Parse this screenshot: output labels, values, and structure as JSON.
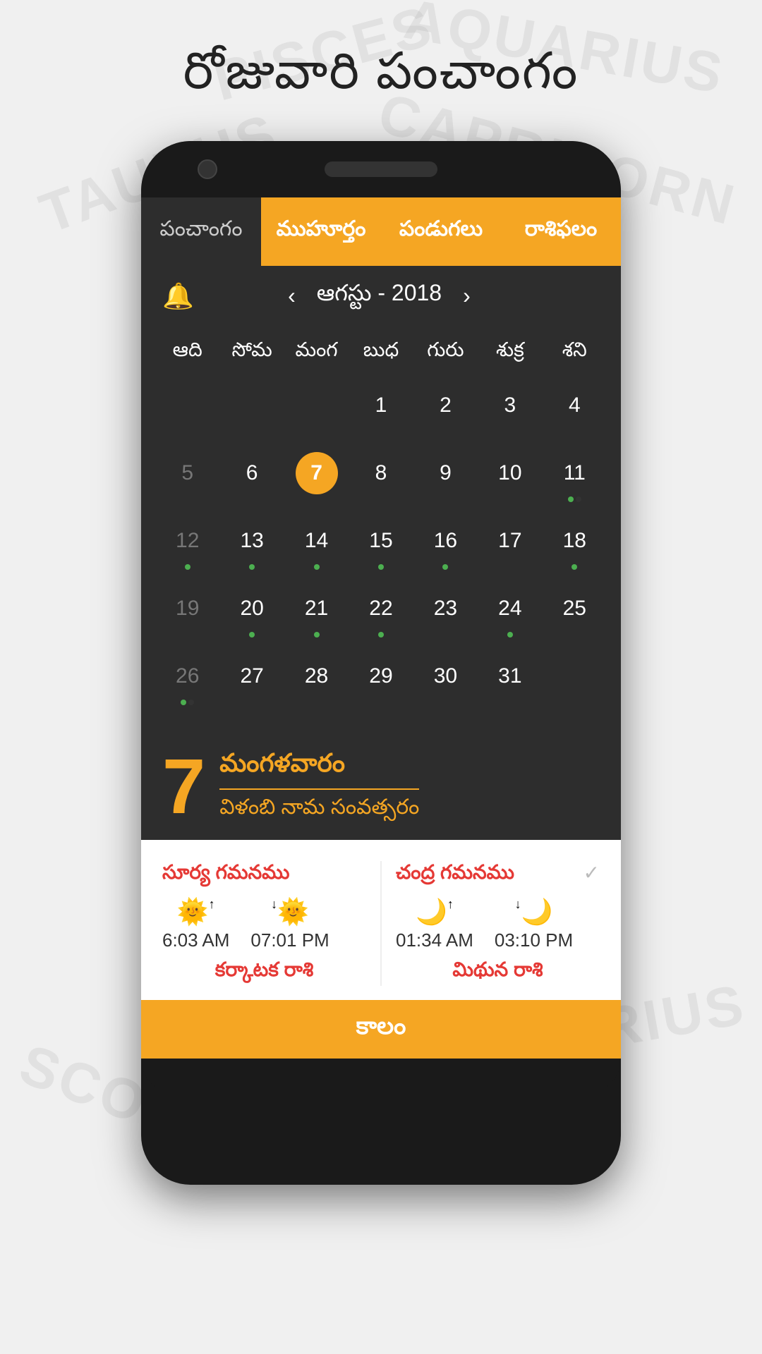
{
  "page": {
    "title": "రోజువారి పంచాంగం"
  },
  "tabs": [
    {
      "id": "panchaangam",
      "label": "పంచాంగం",
      "active": false
    },
    {
      "id": "muhurtam",
      "label": "ముహూర్తం",
      "active": true
    },
    {
      "id": "pandugalu",
      "label": "పండుగలు",
      "active": true
    },
    {
      "id": "rasiphalam",
      "label": "రాశిఫలం",
      "active": true
    }
  ],
  "calendar": {
    "month_label": "ఆగస్టు - 2018",
    "prev_label": "‹",
    "next_label": "›",
    "day_headers": [
      "ఆది",
      "సోమ",
      "మంగ",
      "బుధ",
      "గురు",
      "శుక్ర",
      "శని"
    ],
    "weeks": [
      [
        {
          "num": "",
          "muted": false,
          "today": false,
          "dots": []
        },
        {
          "num": "",
          "muted": false,
          "today": false,
          "dots": []
        },
        {
          "num": "",
          "muted": false,
          "today": false,
          "dots": []
        },
        {
          "num": "1",
          "muted": false,
          "today": false,
          "dots": []
        },
        {
          "num": "2",
          "muted": false,
          "today": false,
          "dots": []
        },
        {
          "num": "3",
          "muted": false,
          "today": false,
          "dots": []
        },
        {
          "num": "4",
          "muted": false,
          "today": false,
          "dots": []
        }
      ],
      [
        {
          "num": "5",
          "muted": true,
          "today": false,
          "dots": []
        },
        {
          "num": "6",
          "muted": false,
          "today": false,
          "dots": []
        },
        {
          "num": "7",
          "muted": false,
          "today": true,
          "dots": []
        },
        {
          "num": "8",
          "muted": false,
          "today": false,
          "dots": []
        },
        {
          "num": "9",
          "muted": false,
          "today": false,
          "dots": []
        },
        {
          "num": "10",
          "muted": false,
          "today": false,
          "dots": []
        },
        {
          "num": "11",
          "muted": false,
          "today": false,
          "dots": [
            "green",
            "dark"
          ]
        }
      ],
      [
        {
          "num": "12",
          "muted": true,
          "today": false,
          "dots": [
            "green"
          ]
        },
        {
          "num": "13",
          "muted": false,
          "today": false,
          "dots": [
            "green"
          ]
        },
        {
          "num": "14",
          "muted": false,
          "today": false,
          "dots": [
            "green"
          ]
        },
        {
          "num": "15",
          "muted": false,
          "today": false,
          "dots": [
            "green"
          ]
        },
        {
          "num": "16",
          "muted": false,
          "today": false,
          "dots": [
            "green"
          ]
        },
        {
          "num": "17",
          "muted": false,
          "today": false,
          "dots": []
        },
        {
          "num": "18",
          "muted": false,
          "today": false,
          "dots": [
            "green"
          ]
        }
      ],
      [
        {
          "num": "19",
          "muted": true,
          "today": false,
          "dots": []
        },
        {
          "num": "20",
          "muted": false,
          "today": false,
          "dots": [
            "green"
          ]
        },
        {
          "num": "21",
          "muted": false,
          "today": false,
          "dots": [
            "green"
          ]
        },
        {
          "num": "22",
          "muted": false,
          "today": false,
          "dots": [
            "green"
          ]
        },
        {
          "num": "23",
          "muted": false,
          "today": false,
          "dots": []
        },
        {
          "num": "24",
          "muted": false,
          "today": false,
          "dots": [
            "green"
          ]
        },
        {
          "num": "25",
          "muted": false,
          "today": false,
          "dots": []
        }
      ],
      [
        {
          "num": "26",
          "muted": true,
          "today": false,
          "dots": [
            "green",
            "dark"
          ]
        },
        {
          "num": "27",
          "muted": false,
          "today": false,
          "dots": []
        },
        {
          "num": "28",
          "muted": false,
          "today": false,
          "dots": []
        },
        {
          "num": "29",
          "muted": false,
          "today": false,
          "dots": []
        },
        {
          "num": "30",
          "muted": false,
          "today": false,
          "dots": []
        },
        {
          "num": "31",
          "muted": false,
          "today": false,
          "dots": []
        },
        {
          "num": "",
          "muted": false,
          "today": false,
          "dots": []
        }
      ]
    ]
  },
  "selected_day": {
    "number": "7",
    "day_name": "మంగళవారం",
    "samvatsaram": "విళంబి నామ సంవత్సరం"
  },
  "sun_section": {
    "title": "సూర్య గమనము",
    "rise_time": "6:03 AM",
    "set_time": "07:01 PM",
    "rasi": "కర్కాటక రాశి"
  },
  "moon_section": {
    "title": "చంద్ర గమనము",
    "rise_time": "01:34 AM",
    "set_time": "03:10 PM",
    "rasi": "మిథున రాశి"
  },
  "kalam": {
    "label": "కాలం"
  },
  "zodiac_bg": {
    "signs": [
      "PISCES",
      "AQUARIUS",
      "TAURUS",
      "CAPRICORN",
      "SAGITTARIUS",
      "SCORPIO"
    ]
  }
}
